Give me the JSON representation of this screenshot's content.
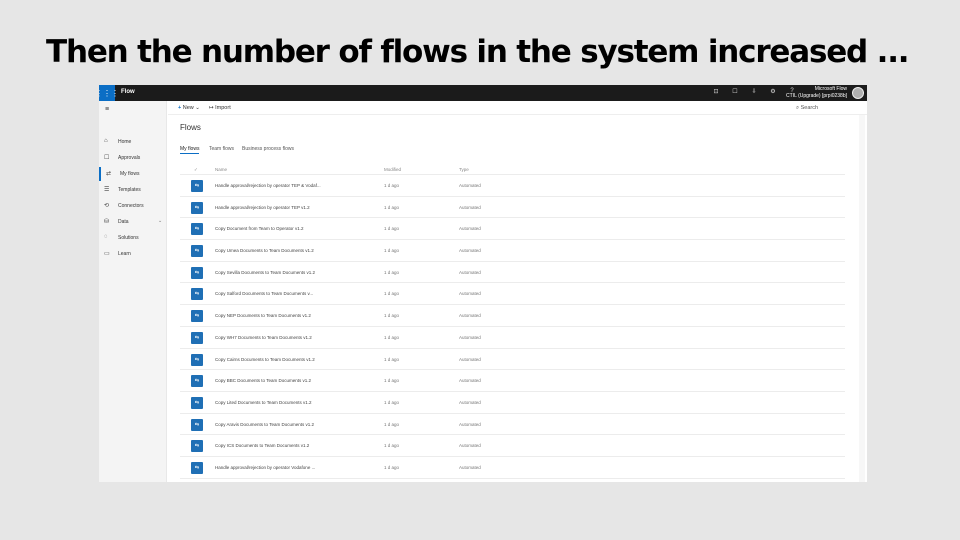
{
  "slide": {
    "title": "Then the number of flows in the system increased ..."
  },
  "app": {
    "waffle_glyph": "⋮⋮⋮",
    "name": "Flow",
    "icons": [
      "⊡",
      "☐",
      "⇩",
      "⚙",
      "?"
    ],
    "tenant_line1": "Microsoft Flow",
    "tenant_line2": "CTIL (Upgrade) [prpi0238b]"
  },
  "commandbar": {
    "new_label": "New",
    "new_caret": "⌄",
    "import_label": "Import",
    "search_label": "Search"
  },
  "sidebar": {
    "items": [
      {
        "icon": "⌂",
        "label": "Home",
        "name": "home"
      },
      {
        "icon": "☐",
        "label": "Approvals",
        "name": "approvals"
      },
      {
        "icon": "⇄",
        "label": "My flows",
        "name": "my-flows"
      },
      {
        "icon": "☰",
        "label": "Templates",
        "name": "templates"
      },
      {
        "icon": "⟲",
        "label": "Connectors",
        "name": "connectors"
      },
      {
        "icon": "⛁",
        "label": "Data",
        "name": "data",
        "chevron": "⌄"
      },
      {
        "icon": "◌",
        "label": "Solutions",
        "name": "solutions"
      },
      {
        "icon": "▭",
        "label": "Learn",
        "name": "learn"
      }
    ]
  },
  "main": {
    "heading": "Flows",
    "tabs": [
      "My flows",
      "Team flows",
      "Business process flows"
    ],
    "columns": {
      "check": "✓",
      "name": "Name",
      "modified": "Modified",
      "type": "Type"
    },
    "flows": [
      {
        "name": "Handle approval/rejection by operator TEP & Vodaf...",
        "modified": "1 d ago",
        "type": "Automated"
      },
      {
        "name": "Handle approval/rejection by operator TEP v1.2",
        "modified": "1 d ago",
        "type": "Automated"
      },
      {
        "name": "Copy Document from Team to Operator v1.2",
        "modified": "1 d ago",
        "type": "Automated"
      },
      {
        "name": "Copy Umea Documents to Team Documents v1.2",
        "modified": "1 d ago",
        "type": "Automated"
      },
      {
        "name": "Copy Sevilla Documents to Team Documents v1.2",
        "modified": "1 d ago",
        "type": "Automated"
      },
      {
        "name": "Copy Salford Documents to Team Documents v...",
        "modified": "1 d ago",
        "type": "Automated"
      },
      {
        "name": "Copy NEP Documents to Team Documents v1.2",
        "modified": "1 d ago",
        "type": "Automated"
      },
      {
        "name": "Copy WH7 Documents to Team Documents v1.2",
        "modified": "1 d ago",
        "type": "Automated"
      },
      {
        "name": "Copy Cairns Documents to Team Documents v1.2",
        "modified": "1 d ago",
        "type": "Automated"
      },
      {
        "name": "Copy BBC Documents to Team Documents v1.2",
        "modified": "1 d ago",
        "type": "Automated"
      },
      {
        "name": "Copy Lited Documents to Team Documents v1.2",
        "modified": "1 d ago",
        "type": "Automated"
      },
      {
        "name": "Copy Aravis Documents to Team Documents v1.2",
        "modified": "1 d ago",
        "type": "Automated"
      },
      {
        "name": "Copy ICS Documents to Team Documents v1.2",
        "modified": "1 d ago",
        "type": "Automated"
      },
      {
        "name": "Handle approval/rejection by operator Vodafone ...",
        "modified": "1 d ago",
        "type": "Automated"
      }
    ]
  }
}
